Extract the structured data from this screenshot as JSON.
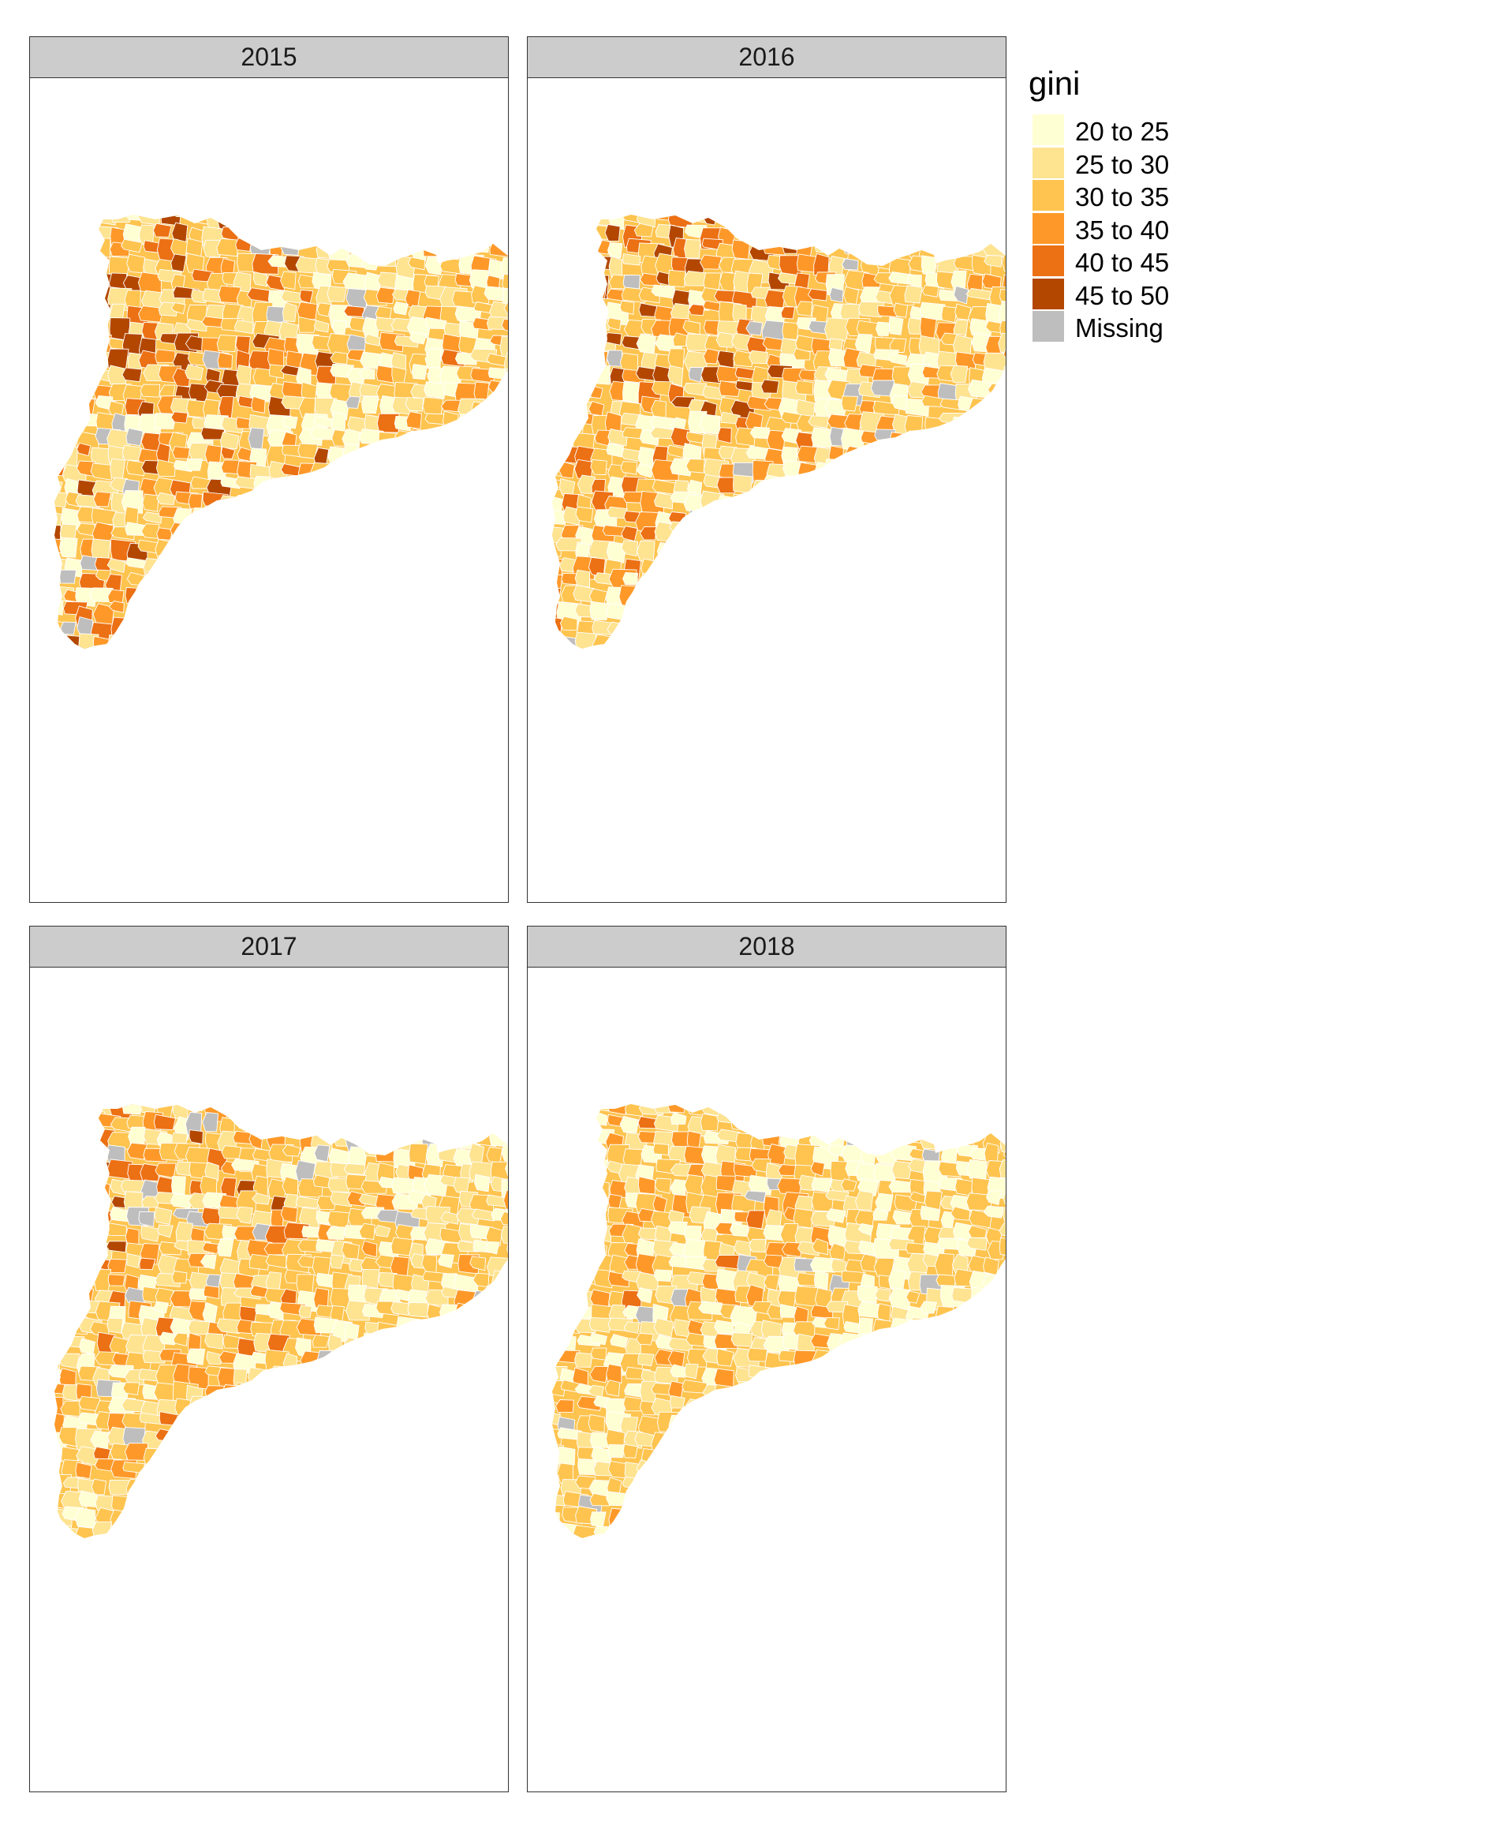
{
  "panels": [
    {
      "label": "2015"
    },
    {
      "label": "2016"
    },
    {
      "label": "2017"
    },
    {
      "label": "2018"
    }
  ],
  "legend": {
    "title": "gini",
    "items": [
      {
        "label": "20 to 25",
        "color": "#ffffd4"
      },
      {
        "label": "25 to 30",
        "color": "#fee391"
      },
      {
        "label": "30 to 35",
        "color": "#fec44f"
      },
      {
        "label": "35 to 40",
        "color": "#fe9929"
      },
      {
        "label": "40 to 45",
        "color": "#ec7014"
      },
      {
        "label": "45 to 50",
        "color": "#b34700"
      },
      {
        "label": "Missing",
        "color": "#bebebe"
      }
    ]
  },
  "chart_data": {
    "type": "heatmap",
    "title": "",
    "layout": "2x2 facets",
    "facets": [
      "2015",
      "2016",
      "2017",
      "2018"
    ],
    "fill_variable": "gini",
    "classes": [
      "20 to 25",
      "25 to 30",
      "30 to 35",
      "35 to 40",
      "40 to 45",
      "45 to 50",
      "Missing"
    ],
    "legend_position": "top-right",
    "border_color": "#ffffff",
    "panel_style": {
      "2015": {
        "dark_share": 0.45
      },
      "2016": {
        "dark_share": 0.4
      },
      "2017": {
        "dark_share": 0.32
      },
      "2018": {
        "dark_share": 0.22
      }
    }
  }
}
